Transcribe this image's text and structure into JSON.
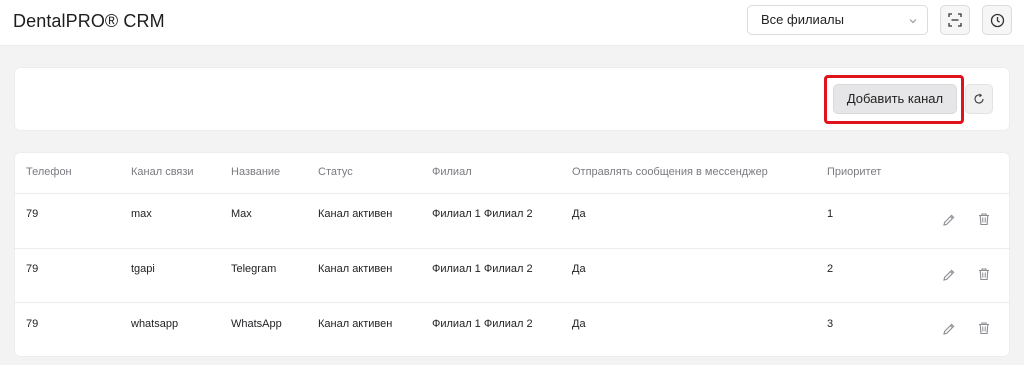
{
  "header": {
    "app_title": "DentalPRO® CRM",
    "branch_select_value": "Все филиалы",
    "branch_select_icon": "chevron-down-icon",
    "scan_icon": "scan-icon",
    "history_icon": "clock-icon"
  },
  "toolbar": {
    "add_channel_label": "Добавить канал",
    "refresh_icon": "refresh-icon",
    "highlight_color": "#e0121b"
  },
  "table": {
    "columns": [
      "Телефон",
      "Канал связи",
      "Название",
      "Статус",
      "Филиал",
      "Отправлять сообщения в мессенджер",
      "Приоритет"
    ],
    "rows": [
      {
        "phone": "79",
        "channel": "max",
        "name": "Max",
        "status": "Канал активен",
        "branch": "Филиал 1 Филиал 2",
        "send_to_messenger": "Да",
        "priority": "1"
      },
      {
        "phone": "79",
        "channel": "tgapi",
        "name": "Telegram",
        "status": "Канал активен",
        "branch": "Филиал 1 Филиал 2",
        "send_to_messenger": "Да",
        "priority": "2"
      },
      {
        "phone": "79",
        "channel": "whatsapp",
        "name": "WhatsApp",
        "status": "Канал активен",
        "branch": "Филиал 1 Филиал 2",
        "send_to_messenger": "Да",
        "priority": "3"
      }
    ],
    "row_actions": [
      "edit-icon",
      "trash-icon"
    ]
  }
}
